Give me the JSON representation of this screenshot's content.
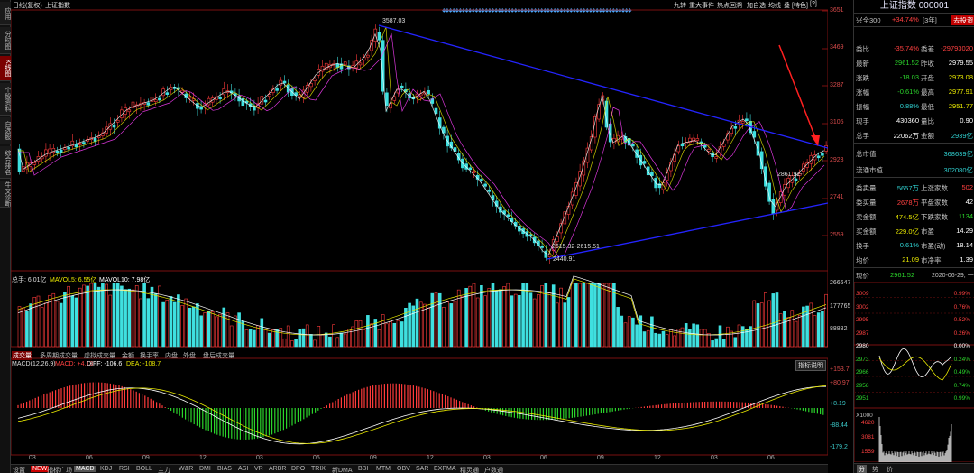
{
  "left_tabs": [
    "应用",
    "分时图",
    "K线图",
    "个股资料",
    "自选股",
    "综合排名",
    "牛叉诊断"
  ],
  "top_bar": {
    "period": "日线(复权)",
    "name": "上证指数",
    "menu": [
      "九转",
      "重大事件",
      "热点回溯",
      "加自选",
      "均线",
      "叠",
      "[特色]",
      "[?]"
    ]
  },
  "price_axis": [
    "3651",
    "3469",
    "3287",
    "3105",
    "2923",
    "2741",
    "2559"
  ],
  "annotations": {
    "high": "3587.03",
    "low": "2440.91",
    "mid": "2615.32-2615.51",
    "right": "2861.92-"
  },
  "volume_legend": {
    "total": "总手: 6.01亿",
    "ma5": "MAVOL5: 6.55亿",
    "ma10": "MAVOL10: 7.98亿"
  },
  "volume_axis": [
    "266647",
    "177765",
    "88882"
  ],
  "volume_tabs": [
    "成交量",
    "多周期成交量",
    "虚拟成交量",
    "金额",
    "换手率",
    "内盘",
    "外盘",
    "盘后成交量"
  ],
  "macd_legend": {
    "name": "MACD(12,26,9)",
    "macd": "MACD: +4.18",
    "diff": "DIFF: -106.6",
    "dea": "DEA: -108.7"
  },
  "macd_button": "指标说明",
  "macd_axis": [
    "+153.7",
    "+80.97",
    "+8.19",
    "-88.44",
    "-179.2"
  ],
  "x_axis": [
    "03",
    "06",
    "09",
    "12",
    "03",
    "06",
    "09",
    "12",
    "03",
    "06",
    "09",
    "12",
    "03",
    "06"
  ],
  "bottom_tabs": [
    "设置",
    "NEW",
    "指标广场",
    "MACD",
    "KDJ",
    "RSI",
    "BOLL",
    "主力",
    "W&R",
    "DMI",
    "BIAS",
    "ASI",
    "VR",
    "ARBR",
    "DPO",
    "TRIX",
    "新DMA",
    "BBI",
    "MTM",
    "OBV",
    "SAR",
    "EXPMA",
    "精灵通",
    "户数通"
  ],
  "right_panel": {
    "title": "上证指数 000001",
    "rows": [
      {
        "l1": "兴全300",
        "v1": "+34.74%",
        "v1b": "[3年]",
        "btn": "去投资"
      },
      {
        "l1": "委比",
        "v1": "-35.74%",
        "l2": "委差",
        "v2": "-29793020"
      },
      {
        "l1": "最新",
        "v1": "2961.52",
        "l2": "昨收",
        "v2": "2979.55"
      },
      {
        "l1": "涨跌",
        "v1": "-18.03",
        "l2": "开盘",
        "v2": "2973.08"
      },
      {
        "l1": "涨幅",
        "v1": "-0.61%",
        "l2": "最高",
        "v2": "2977.91"
      },
      {
        "l1": "振幅",
        "v1": "0.88%",
        "l2": "最低",
        "v2": "2951.77"
      },
      {
        "l1": "现手",
        "v1": "430360",
        "l2": "量比",
        "v2": "0.90"
      },
      {
        "l1": "总手",
        "v1": "22062万",
        "l2": "金额",
        "v2": "2939亿"
      },
      {
        "l1": "总市值",
        "v2": "368639亿"
      },
      {
        "l1": "流通市值",
        "v2": "302080亿"
      },
      {
        "l1": "委卖量",
        "v1": "5657万",
        "l2": "上涨家数",
        "v2": "502"
      },
      {
        "l1": "委买量",
        "v1": "2678万",
        "l2": "平盘家数",
        "v2": "42"
      },
      {
        "l1": "卖金额",
        "v1": "474.5亿",
        "l2": "下跌家数",
        "v2": "1134"
      },
      {
        "l1": "买金额",
        "v1": "229.0亿",
        "l2": "市盈",
        "v2": "14.29"
      },
      {
        "l1": "换手",
        "v1": "0.61%",
        "l2": "市盈(动)",
        "v2": "18.14"
      },
      {
        "l1": "均价",
        "v1": "21.09",
        "l2": "市净率",
        "v2": "1.39"
      }
    ],
    "now_row": {
      "l1": "现价",
      "v1": "2961.52",
      "date": "2020-06-29, 一"
    },
    "mini_price": [
      "3009",
      "3002",
      "2995",
      "2987",
      "2980",
      "2973",
      "2966",
      "2958",
      "2951"
    ],
    "mini_pct": [
      "0.99%",
      "0.76%",
      "0.52%",
      "0.26%",
      "0.00%",
      "0.24%",
      "0.49%",
      "0.74%",
      "0.99%"
    ],
    "mini_vol": [
      "4620",
      "3081",
      "1559"
    ],
    "mini_vol_unit": "X1000",
    "bottom_tabs": [
      "分",
      "势",
      "价"
    ]
  }
}
